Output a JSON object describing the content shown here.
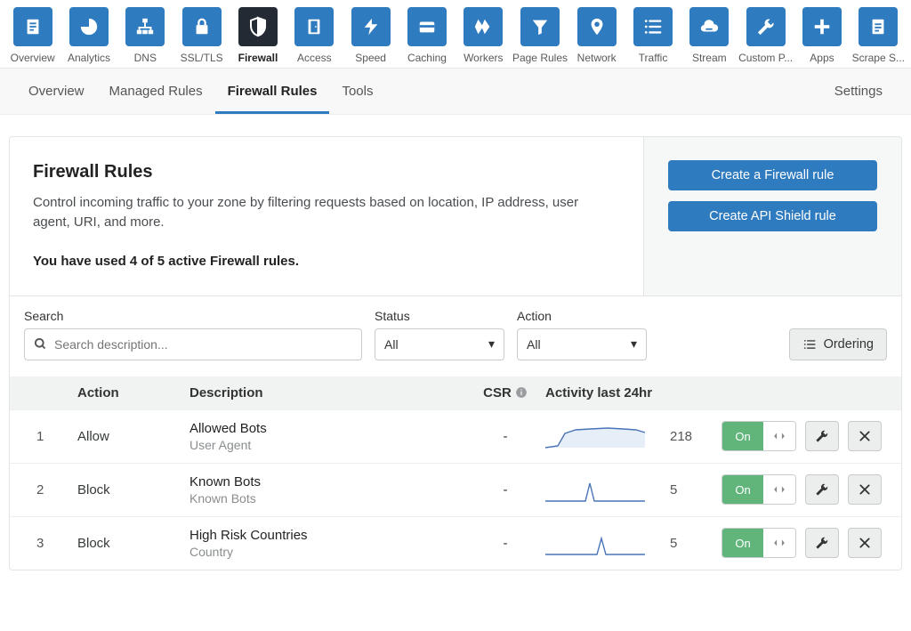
{
  "topnav": [
    {
      "label": "Overview",
      "icon": "doc"
    },
    {
      "label": "Analytics",
      "icon": "pie"
    },
    {
      "label": "DNS",
      "icon": "sitemap"
    },
    {
      "label": "SSL/TLS",
      "icon": "lock"
    },
    {
      "label": "Firewall",
      "icon": "shield",
      "active": true
    },
    {
      "label": "Access",
      "icon": "door"
    },
    {
      "label": "Speed",
      "icon": "bolt"
    },
    {
      "label": "Caching",
      "icon": "card"
    },
    {
      "label": "Workers",
      "icon": "workers"
    },
    {
      "label": "Page Rules",
      "icon": "funnel"
    },
    {
      "label": "Network",
      "icon": "pin"
    },
    {
      "label": "Traffic",
      "icon": "lines"
    },
    {
      "label": "Stream",
      "icon": "cloud"
    },
    {
      "label": "Custom P...",
      "icon": "wrench"
    },
    {
      "label": "Apps",
      "icon": "plus"
    },
    {
      "label": "Scrape S...",
      "icon": "page"
    }
  ],
  "subnav": {
    "items": [
      "Overview",
      "Managed Rules",
      "Firewall Rules",
      "Tools"
    ],
    "active": "Firewall Rules",
    "right": "Settings"
  },
  "card": {
    "title": "Firewall Rules",
    "description": "Control incoming traffic to your zone by filtering requests based on location, IP address, user agent, URI, and more.",
    "usage": "You have used 4 of 5 active Firewall rules.",
    "buttons": {
      "create_rule": "Create a Firewall rule",
      "create_api_shield": "Create API Shield rule"
    }
  },
  "filters": {
    "search_label": "Search",
    "search_placeholder": "Search description...",
    "status_label": "Status",
    "status_value": "All",
    "action_label": "Action",
    "action_value": "All",
    "ordering": "Ordering"
  },
  "columns": {
    "action": "Action",
    "description": "Description",
    "csr": "CSR",
    "activity": "Activity last 24hr"
  },
  "rows": [
    {
      "idx": "1",
      "action": "Allow",
      "title": "Allowed Bots",
      "sub": "User Agent",
      "csr": "-",
      "count": "218",
      "spark": "big"
    },
    {
      "idx": "2",
      "action": "Block",
      "title": "Known Bots",
      "sub": "Known Bots",
      "csr": "-",
      "count": "5",
      "spark": "spike"
    },
    {
      "idx": "3",
      "action": "Block",
      "title": "High Risk Countries",
      "sub": "Country",
      "csr": "-",
      "count": "5",
      "spark": "spike2"
    }
  ],
  "toggle_on": "On"
}
